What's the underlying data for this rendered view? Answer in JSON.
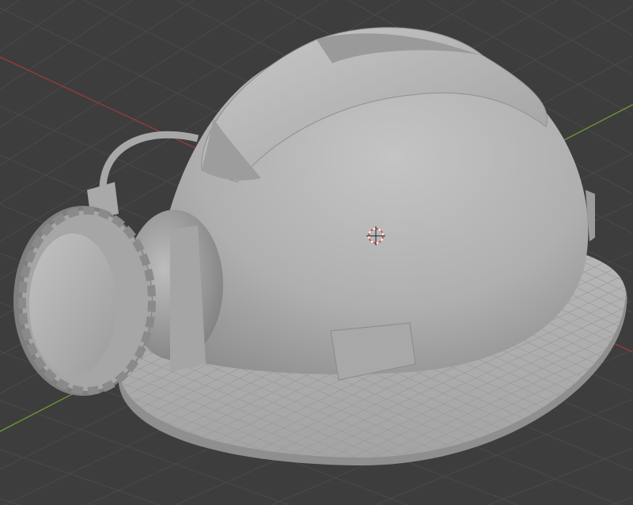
{
  "viewport": {
    "mode": "solid-shading",
    "object": "mining-helmet-with-headlamp",
    "colors": {
      "background": "#3d3d3d",
      "grid": "#4a4a4a",
      "x_axis": "#9a3a3a",
      "y_axis": "#6f9a2e",
      "model": "#b4b4b4"
    },
    "icons": [
      "3d-cursor-icon"
    ]
  }
}
